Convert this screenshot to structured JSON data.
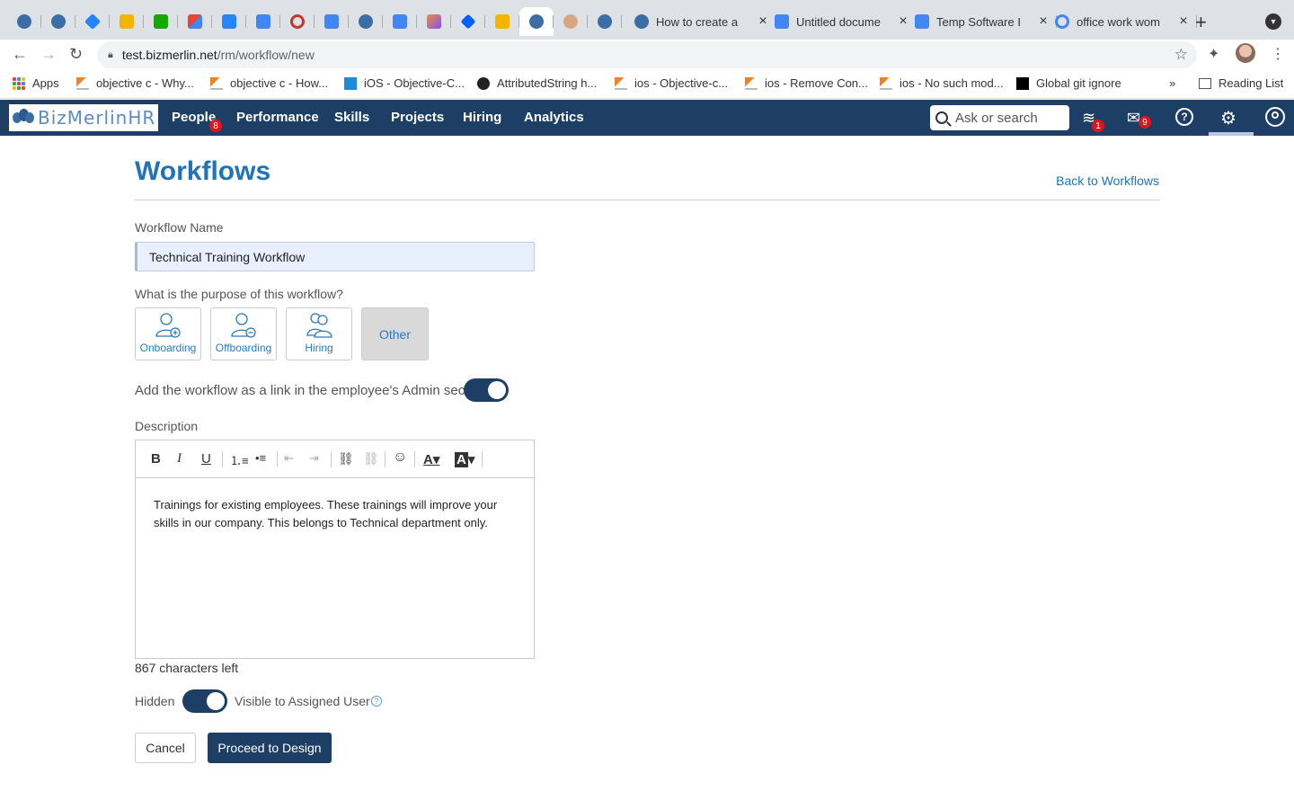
{
  "browser": {
    "tabs": [
      {
        "title": "How to create a",
        "icon": "bizmerlin-icon"
      },
      {
        "title": "Untitled docume",
        "icon": "google-docs-icon"
      },
      {
        "title": "Temp Software I",
        "icon": "google-docs-icon"
      },
      {
        "title": "office work wom",
        "icon": "google-icon"
      }
    ],
    "url_host": "test.bizmerlin.net",
    "url_path": "/rm/workflow/new",
    "bookmarks": [
      {
        "label": "Apps"
      },
      {
        "label": "objective c - Why..."
      },
      {
        "label": "objective c - How..."
      },
      {
        "label": "iOS - Objective-C..."
      },
      {
        "label": "AttributedString h..."
      },
      {
        "label": "ios - Objective-c..."
      },
      {
        "label": "ios - Remove Con..."
      },
      {
        "label": "ios - No such mod..."
      },
      {
        "label": "Global git ignore"
      }
    ],
    "more_bookmarks": "»",
    "reading_list": "Reading List"
  },
  "app": {
    "logo_text": "BizMerlinHR",
    "nav": [
      "People",
      "Performance",
      "Skills",
      "Projects",
      "Hiring",
      "Analytics"
    ],
    "people_badge": "8",
    "search_placeholder": "Ask or search",
    "notifications_badge": "1",
    "messages_badge": "9"
  },
  "page": {
    "title": "Workflows",
    "back_link": "Back to Workflows",
    "workflow_name_label": "Workflow Name",
    "workflow_name_value": "Technical Training Workflow",
    "purpose_label": "What is the purpose of this workflow?",
    "purpose_options": [
      "Onboarding",
      "Offboarding",
      "Hiring",
      "Other"
    ],
    "purpose_selected": "Other",
    "admin_link_label": "Add the workflow as a link in the employee's Admin section",
    "admin_link_enabled": true,
    "description_label": "Description",
    "description_text": "Trainings for existing employees. These trainings will improve your skills in our company. This belongs to Technical department only.",
    "chars_left": "867 characters left",
    "visibility_hidden_label": "Hidden",
    "visibility_visible_label": "Visible to Assigned User",
    "visibility_enabled": true,
    "cancel_label": "Cancel",
    "proceed_label": "Proceed to Design"
  },
  "colors": {
    "navbar": "#1d3f66",
    "accent": "#1f74b8",
    "badge": "#e0141e"
  }
}
